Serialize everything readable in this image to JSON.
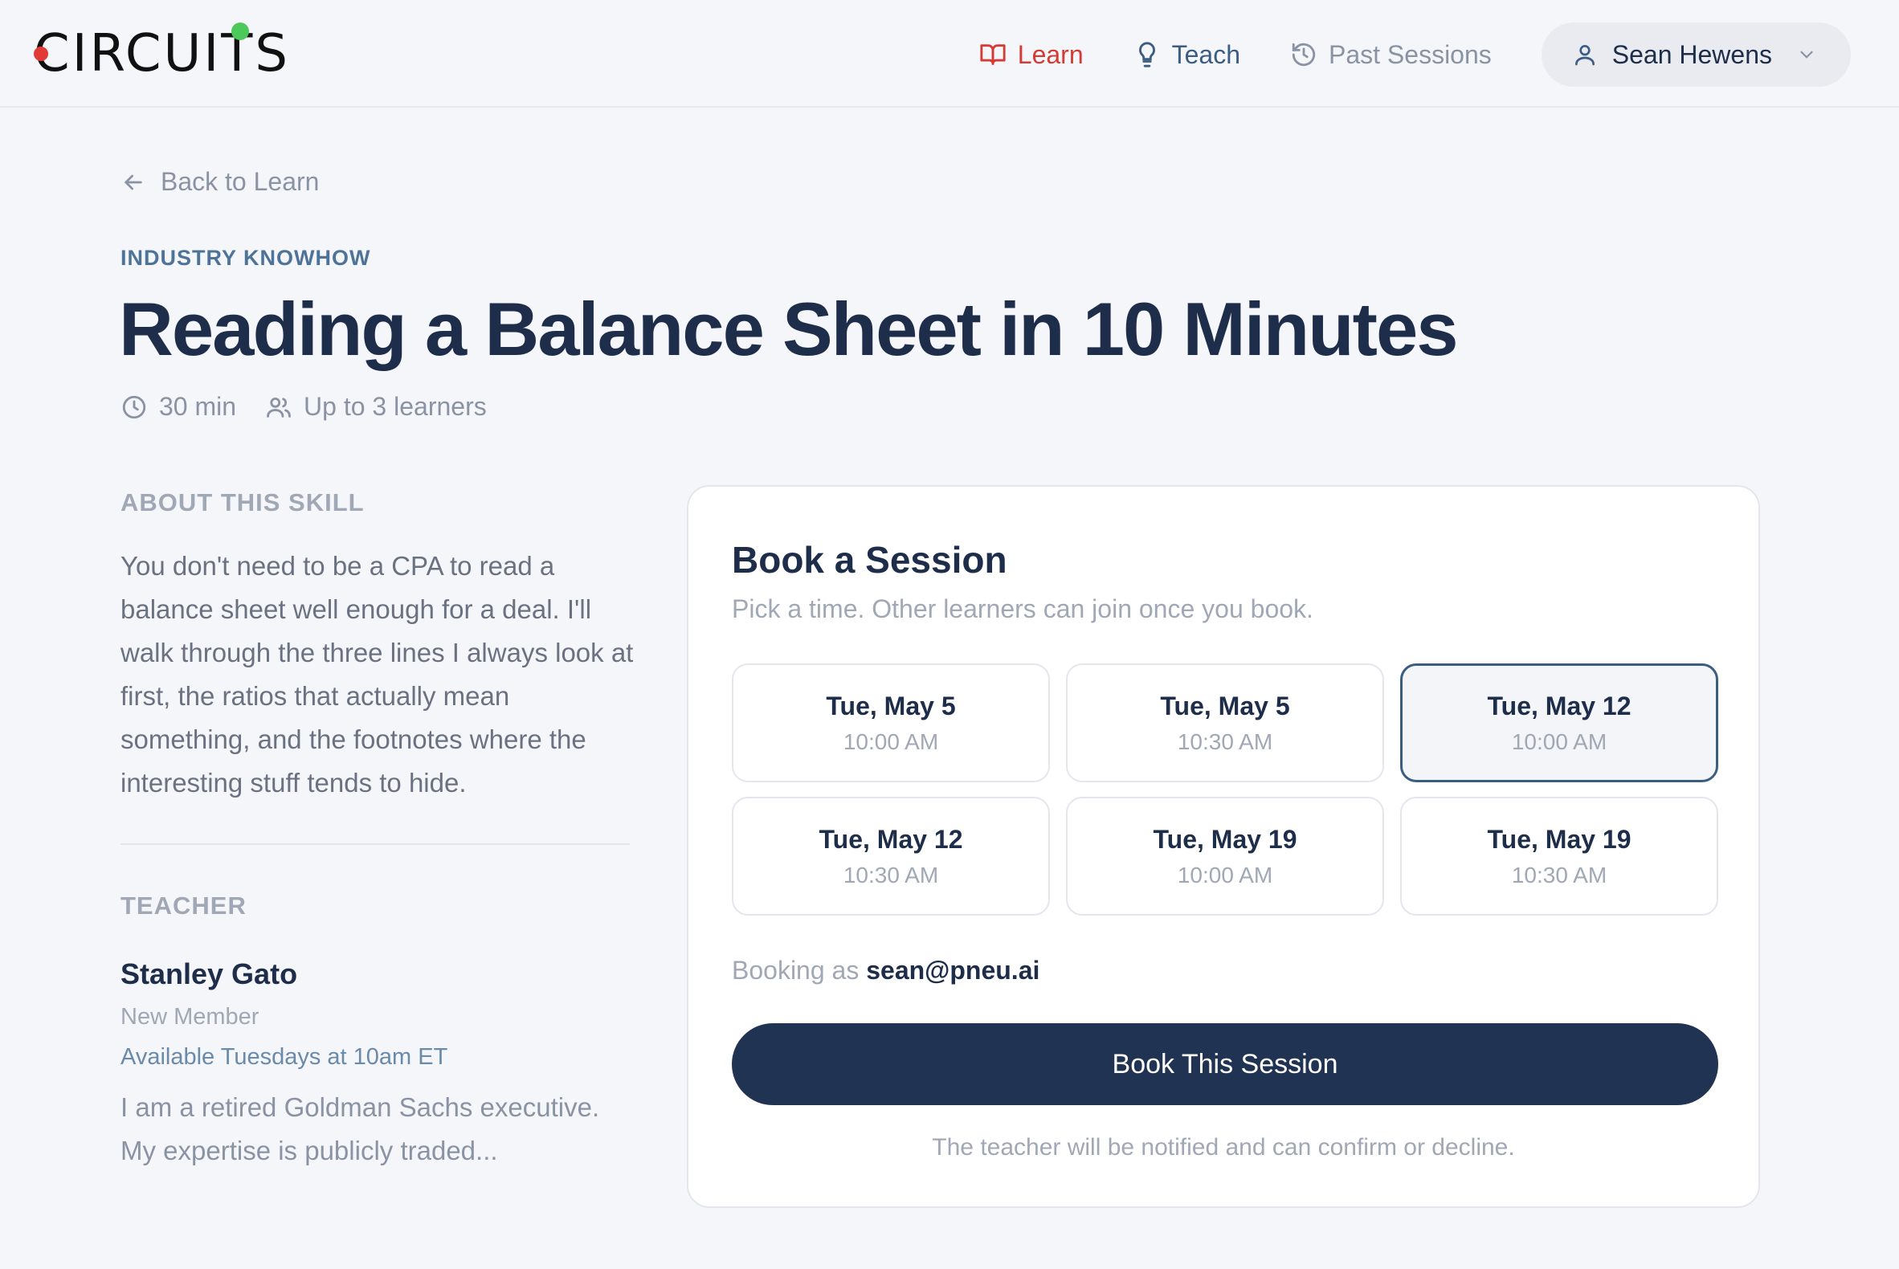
{
  "header": {
    "logo": "CIRCUITS",
    "nav": [
      {
        "label": "Learn",
        "icon": "book-icon"
      },
      {
        "label": "Teach",
        "icon": "lightbulb-icon"
      },
      {
        "label": "Past Sessions",
        "icon": "history-icon"
      }
    ],
    "user": {
      "name": "Sean Hewens",
      "icon": "user-icon"
    }
  },
  "back_link": "Back to Learn",
  "skill": {
    "category": "INDUSTRY KNOWHOW",
    "title": "Reading a Balance Sheet in 10 Minutes",
    "duration": "30 min",
    "capacity": "Up to 3 learners"
  },
  "about": {
    "label": "ABOUT THIS SKILL",
    "text": "You don't need to be a CPA to read a balance sheet well enough for a deal. I'll walk through the three lines I always look at first, the ratios that actually mean something, and the footnotes where the interesting stuff tends to hide."
  },
  "teacher": {
    "label": "TEACHER",
    "name": "Stanley Gato",
    "role": "New Member",
    "availability": "Available Tuesdays at 10am ET",
    "bio": "I am a retired Goldman Sachs executive. My expertise is publicly traded..."
  },
  "booking": {
    "title": "Book a Session",
    "subtitle": "Pick a time. Other learners can join once you book.",
    "slots": [
      {
        "date": "Tue, May 5",
        "time": "10:00 AM"
      },
      {
        "date": "Tue, May 5",
        "time": "10:30 AM"
      },
      {
        "date": "Tue, May 12",
        "time": "10:00 AM"
      },
      {
        "date": "Tue, May 12",
        "time": "10:30 AM"
      },
      {
        "date": "Tue, May 19",
        "time": "10:00 AM"
      },
      {
        "date": "Tue, May 19",
        "time": "10:30 AM"
      }
    ],
    "selected_slot": 2,
    "booking_as_label": "Booking as",
    "email": "sean@pneu.ai",
    "button": "Book This Session",
    "note": "The teacher will be notified and can confirm or decline."
  },
  "colors": {
    "accent_red": "#d43b34",
    "navy": "#213352",
    "teach_blue": "#3c5d82"
  }
}
